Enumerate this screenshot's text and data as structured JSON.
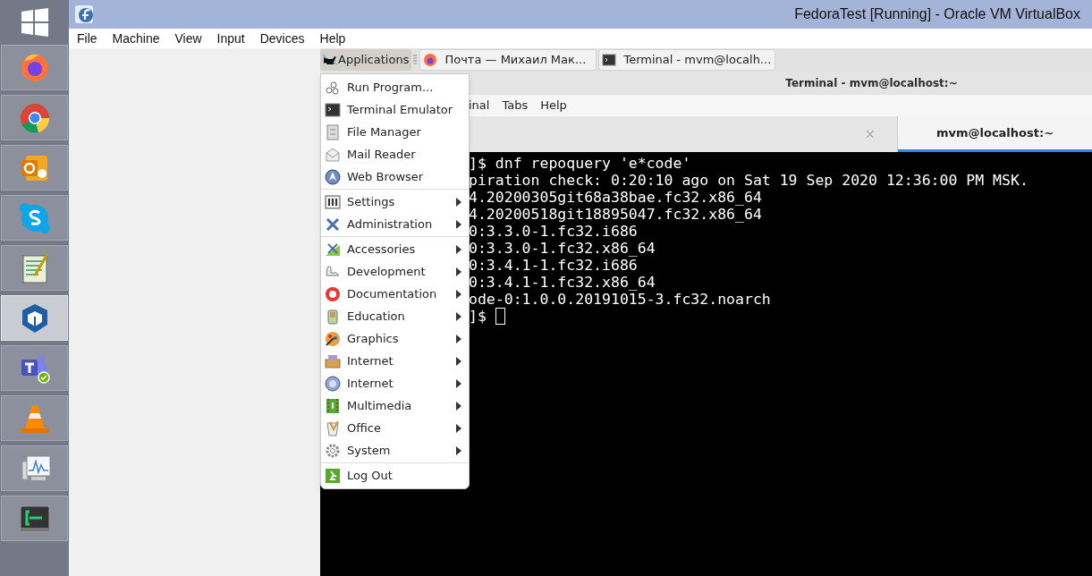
{
  "taskbar": {
    "items": [
      {
        "selected": false
      },
      {
        "selected": false
      },
      {
        "selected": false
      },
      {
        "selected": false
      },
      {
        "selected": false
      },
      {
        "selected": true
      },
      {
        "selected": false
      },
      {
        "selected": false
      },
      {
        "selected": false
      },
      {
        "selected": false
      }
    ]
  },
  "window": {
    "title": "FedoraTest [Running] - Oracle VM VirtualBox",
    "menu": [
      "File",
      "Machine",
      "View",
      "Input",
      "Devices",
      "Help"
    ]
  },
  "guest": {
    "panel": {
      "applications": "Applications",
      "tasks": [
        {
          "label": "Почта — Михаил Мак..."
        },
        {
          "label": "Terminal - mvm@localh..."
        }
      ]
    },
    "terminal": {
      "title": "Terminal - mvm@localhost:~",
      "menu": [
        "inal",
        "Tabs",
        "Help"
      ],
      "tabs": [
        {
          "label": "×",
          "selected": false
        },
        {
          "label": "mvm@localhost:~",
          "selected": true
        }
      ],
      "lines": [
        "]$ dnf repoquery 'e*code'",
        "piration check: 0:20:10 ago on Sat 19 Sep 2020 12:36:00 PM MSK.",
        "4.20200305git68a38bae.fc32.x86_64",
        "4.20200518git18895047.fc32.x86_64",
        "0:3.3.0-1.fc32.i686",
        "0:3.3.0-1.fc32.x86_64",
        "0:3.4.1-1.fc32.i686",
        "0:3.4.1-1.fc32.x86_64",
        "ode-0:1.0.0.20191015-3.fc32.noarch",
        "]$ "
      ]
    },
    "menu": {
      "sections": [
        [
          {
            "label": "Run Program...",
            "submenu": false
          },
          {
            "label": "Terminal Emulator",
            "submenu": false
          },
          {
            "label": "File Manager",
            "submenu": false
          },
          {
            "label": "Mail Reader",
            "submenu": false
          },
          {
            "label": "Web Browser",
            "submenu": false
          }
        ],
        [
          {
            "label": "Settings",
            "submenu": true
          },
          {
            "label": "Administration",
            "submenu": true
          }
        ],
        [
          {
            "label": "Accessories",
            "submenu": true
          },
          {
            "label": "Development",
            "submenu": true
          },
          {
            "label": "Documentation",
            "submenu": true
          },
          {
            "label": "Education",
            "submenu": true
          },
          {
            "label": "Graphics",
            "submenu": true
          },
          {
            "label": "Internet",
            "submenu": true
          },
          {
            "label": "Internet",
            "submenu": true
          },
          {
            "label": "Multimedia",
            "submenu": true
          },
          {
            "label": "Office",
            "submenu": true
          },
          {
            "label": "System",
            "submenu": true
          }
        ],
        [
          {
            "label": "Log Out",
            "submenu": false
          }
        ]
      ]
    }
  }
}
